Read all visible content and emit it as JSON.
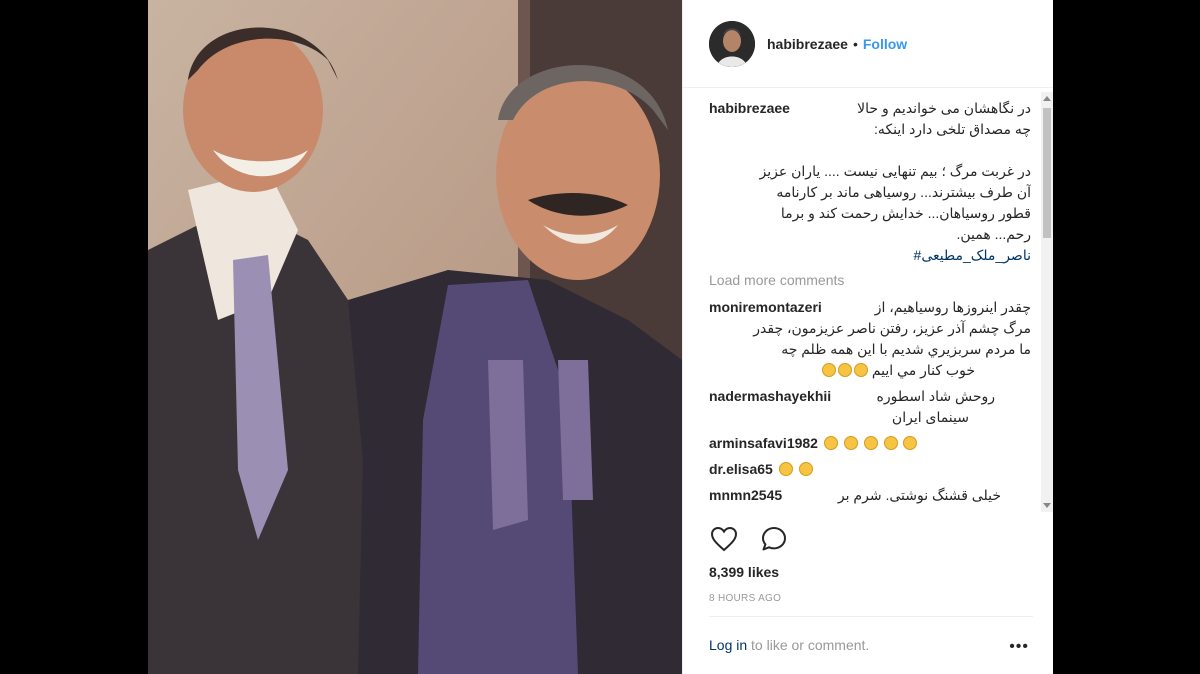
{
  "post": {
    "username": "habibrezaee",
    "separator": "•",
    "follow_label": "Follow",
    "caption": {
      "username": "habibrezaee",
      "lines": [
        "در نگاهشان می خواندیم و حالا",
        "چه مصداق تلخی دارد اینکه:",
        "",
        "در غربت مرگ ؛ بیم تنهایی نیست .... یاران عزیز",
        "آن طرف بیشترند... روسیاهی ماند بر کارنامه",
        "قطور روسیاهان... خدایش رحمت کند و برما",
        "رحم... همین."
      ],
      "hashtag": "#ناصر_ملک_مطیعی"
    },
    "load_more": "Load more comments",
    "comments": [
      {
        "user": "moniremontazeri",
        "lines": [
          "چقدر اینروزها روسیاهیم، از",
          "مرگ چشم آذر عزیز، رفتن ناصر عزیزمون، چقدر",
          "ما مردم سربزیري شدیم با این همه ظلم چه",
          "خوب کنار مي ایيم"
        ],
        "emoji_count": 3
      },
      {
        "user": "nadermashayekhii",
        "lines": [
          "روحش شاد اسطوره",
          "سینمای ایران"
        ],
        "emoji_count": 0
      },
      {
        "user": "arminsafavi1982",
        "lines": [
          ""
        ],
        "emoji_count": 5
      },
      {
        "user": "dr.elisa65",
        "lines": [
          ""
        ],
        "emoji_count": 2
      },
      {
        "user": "mnmn2545",
        "lines": [
          "خیلی قشنگ نوشتی. شرم بر"
        ],
        "emoji_count": 0
      }
    ],
    "likes": "8,399 likes",
    "time": "8 HOURS AGO",
    "login_link": "Log in",
    "login_text": " to like or comment.",
    "more_label": "•••",
    "icons": {
      "like": "heart-icon",
      "comment": "comment-icon",
      "avatar": "avatar-image",
      "photo": "vintage-photo-two-men"
    },
    "colors": {
      "link": "#3897f0",
      "hashtag": "#003569",
      "muted": "#999999",
      "text": "#262626"
    }
  }
}
